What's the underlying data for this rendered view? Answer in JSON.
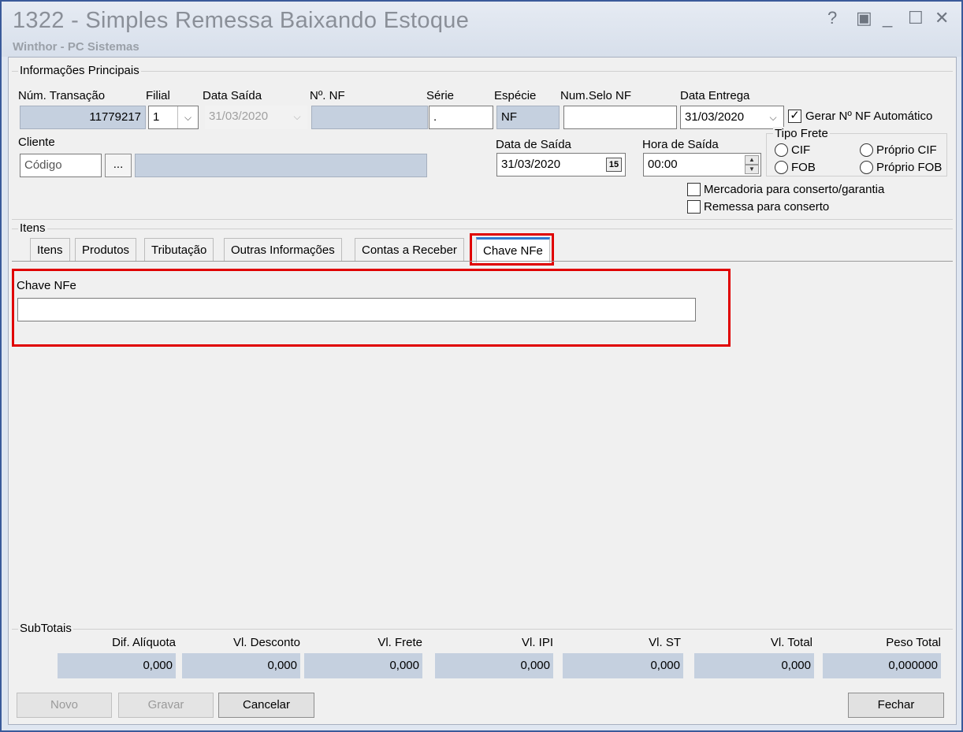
{
  "window": {
    "title": "1322 - Simples Remessa Baixando Estoque",
    "subtitle": "Winthor - PC Sistemas",
    "controls": [
      "?",
      "▣",
      "_",
      "☐",
      "✕"
    ]
  },
  "principal": {
    "group_label": "Informações Principais",
    "num_transacao": {
      "label": "Núm. Transação",
      "value": "11779217"
    },
    "filial": {
      "label": "Filial",
      "value": "1"
    },
    "data_saida": {
      "label": "Data Saída",
      "value": "31/03/2020"
    },
    "num_nf": {
      "label": "Nº. NF",
      "value": ""
    },
    "serie": {
      "label": "Série",
      "value": "."
    },
    "especie": {
      "label": "Espécie",
      "value": "NF"
    },
    "num_selo": {
      "label": "Num.Selo NF",
      "value": ""
    },
    "data_entrega": {
      "label": "Data Entrega",
      "value": "31/03/2020"
    },
    "gerar_nf": {
      "label": "Gerar Nº NF Automático",
      "checked": true,
      "mark": "✓"
    },
    "cliente": {
      "label": "Cliente",
      "codigo_placeholder": "Código",
      "browse_label": "...",
      "nome": ""
    },
    "data_de_saida": {
      "label": "Data de Saída",
      "value": "31/03/2020",
      "calendar_label": "15"
    },
    "hora_de_saida": {
      "label": "Hora de Saída",
      "value": "00:00"
    },
    "tipo_frete": {
      "label": "Tipo Frete",
      "options": [
        "CIF",
        "FOB",
        "Próprio CIF",
        "Próprio FOB"
      ]
    },
    "mercadoria_conserto": {
      "label": "Mercadoria para conserto/garantia",
      "checked": false
    },
    "remessa_conserto": {
      "label": "Remessa para conserto",
      "checked": false
    }
  },
  "itens": {
    "group_label": "Itens",
    "tabs": [
      "Itens",
      "Produtos",
      "Tributação",
      "Outras Informações",
      "Contas a Receber",
      "Chave NFe"
    ],
    "active_tab": "Chave NFe",
    "chave_nfe": {
      "label": "Chave NFe",
      "value": ""
    }
  },
  "subtotais": {
    "group_label": "SubTotais",
    "fields": [
      {
        "label": "Dif. Alíquota",
        "value": "0,000"
      },
      {
        "label": "Vl. Desconto",
        "value": "0,000"
      },
      {
        "label": "Vl. Frete",
        "value": "0,000"
      },
      {
        "label": "Vl. IPI",
        "value": "0,000"
      },
      {
        "label": "Vl. ST",
        "value": "0,000"
      },
      {
        "label": "Vl. Total",
        "value": "0,000"
      },
      {
        "label": "Peso Total",
        "value": "0,000000"
      }
    ]
  },
  "buttons": {
    "novo": "Novo",
    "gravar": "Gravar",
    "cancelar": "Cancelar",
    "fechar": "Fechar"
  },
  "colors": {
    "highlight": "#e00000",
    "readonly_field": "#c5d0df",
    "tab_accent": "#2f7ad1"
  }
}
